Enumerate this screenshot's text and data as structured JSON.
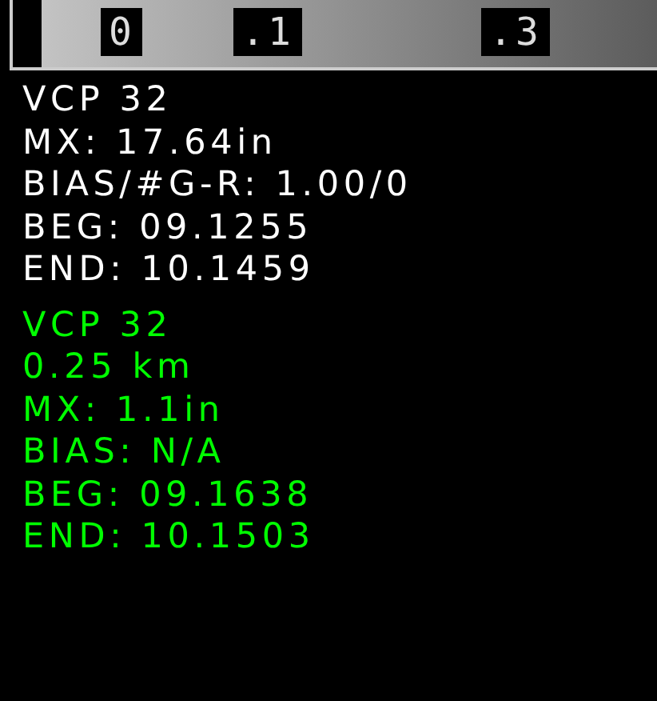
{
  "legend": {
    "labels": [
      ".1",
      ".3"
    ],
    "first_label": "0"
  },
  "blocks": [
    {
      "color": "#ffffff",
      "lines": [
        "VCP 32",
        "MX: 17.64in",
        "BIAS/#G-R: 1.00/0",
        "BEG: 09.1255",
        "END: 10.1459"
      ]
    },
    {
      "color": "#00ff00",
      "lines": [
        "VCP 32",
        "0.25 km",
        "MX: 1.1in",
        "BIAS: N/A",
        "BEG: 09.1638",
        "END: 10.1503"
      ]
    }
  ]
}
